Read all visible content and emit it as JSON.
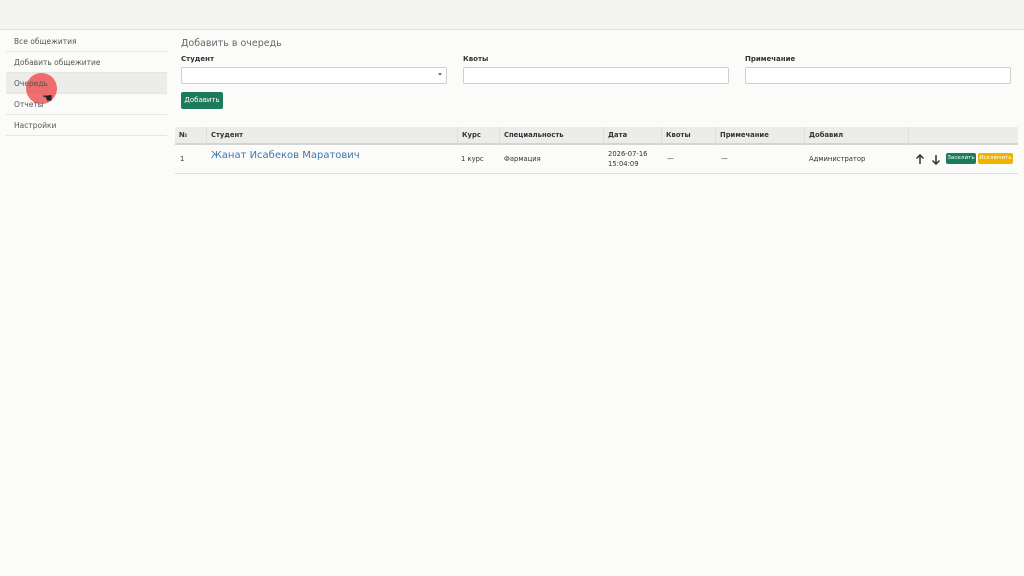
{
  "sidebar": {
    "items": [
      {
        "label": "Все общежития"
      },
      {
        "label": "Добавить общежитие"
      },
      {
        "label": "Очередь"
      },
      {
        "label": "Отчеты"
      },
      {
        "label": "Настройки"
      }
    ]
  },
  "form": {
    "title": "Добавить в очередь",
    "student_label": "Студент",
    "student_value": "",
    "quota_label": "Квоты",
    "quota_value": "",
    "note_label": "Примечание",
    "note_value": "",
    "add_button": "Добавить"
  },
  "table": {
    "headers": [
      "№",
      "Студент",
      "Курс",
      "Специальность",
      "Дата",
      "Квоты",
      "Примечание",
      "Добавил"
    ],
    "rows": [
      {
        "num": "1",
        "student": "Жанат Исабеков Маратович",
        "course": "1 курс",
        "specialty": "Фармация",
        "date_line1": "2026-07-16",
        "date_line2": "15:04:09",
        "quota": "—",
        "note": "—",
        "added_by": "Администратор",
        "settle_label": "Заселить",
        "exclude_label": "Исключить"
      }
    ]
  },
  "colors": {
    "primary": "#1d7a5a",
    "warning": "#f0b400",
    "link": "#3d78a8",
    "cursor_highlight": "#eb5050"
  }
}
